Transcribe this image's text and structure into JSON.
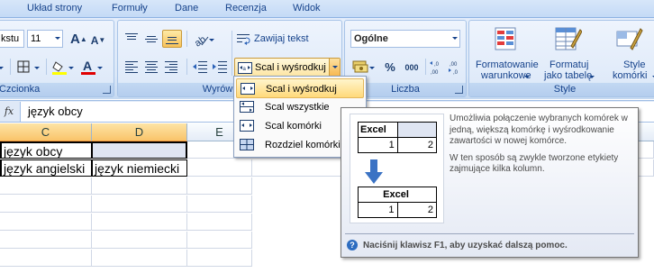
{
  "tabs": [
    "Układ strony",
    "Formuły",
    "Dane",
    "Recenzja",
    "Widok"
  ],
  "font_group": {
    "font_name": "kstu",
    "font_size": "11",
    "label": "Czcionka",
    "grow_glyph": "A",
    "shrink_glyph": "A",
    "font_color_glyph": "A",
    "colors": {
      "highlight": "#ffff00",
      "font": "#e00000"
    }
  },
  "alignment_group": {
    "label": "Wyrównanie",
    "wrap_text": "Zawijaj tekst",
    "merge_center": "Scal i wyśrodkuj"
  },
  "number_group": {
    "format": "Ogólne",
    "label": "Liczba",
    "percent": "%",
    "thousands": "000",
    "inc_decimal": ",00→,0",
    "dec_decimal": ",00→,0"
  },
  "style_group": {
    "label": "Style",
    "conditional_formatting": [
      "Formatowanie",
      "warunkowe"
    ],
    "format_as_table": [
      "Formatuj",
      "jako tabelę"
    ],
    "cell_styles": [
      "Style",
      "komórki"
    ]
  },
  "formula_bar": {
    "fx": "fx",
    "value": "język obcy"
  },
  "grid": {
    "columns": [
      "C",
      "D",
      "E"
    ],
    "rows": [
      [
        "język obcy",
        "",
        ""
      ],
      [
        "język angielski",
        "język niemiecki",
        ""
      ]
    ]
  },
  "merge_menu": {
    "items": [
      {
        "label": "Scal i wyśrodkuj",
        "highlighted": true
      },
      {
        "label": "Scal wszystkie",
        "highlighted": false
      },
      {
        "label": "Scal komórki",
        "highlighted": false
      },
      {
        "label": "Rozdziel komórki",
        "highlighted": false
      }
    ]
  },
  "tooltip": {
    "illustration": {
      "before": {
        "header": "Excel",
        "values": [
          "1",
          "2"
        ]
      },
      "after": {
        "header": "Excel",
        "values": [
          "1",
          "2"
        ]
      }
    },
    "description": "Umożliwia połączenie wybranych komórek w jedną, większą komórkę i wyśrodkowanie zawartości w nowej komórce.",
    "detail": "W ten sposób są zwykle tworzone etykiety zajmujące kilka kolumn.",
    "help": "Naciśnij klawisz F1, aby uzyskać dalszą pomoc."
  }
}
